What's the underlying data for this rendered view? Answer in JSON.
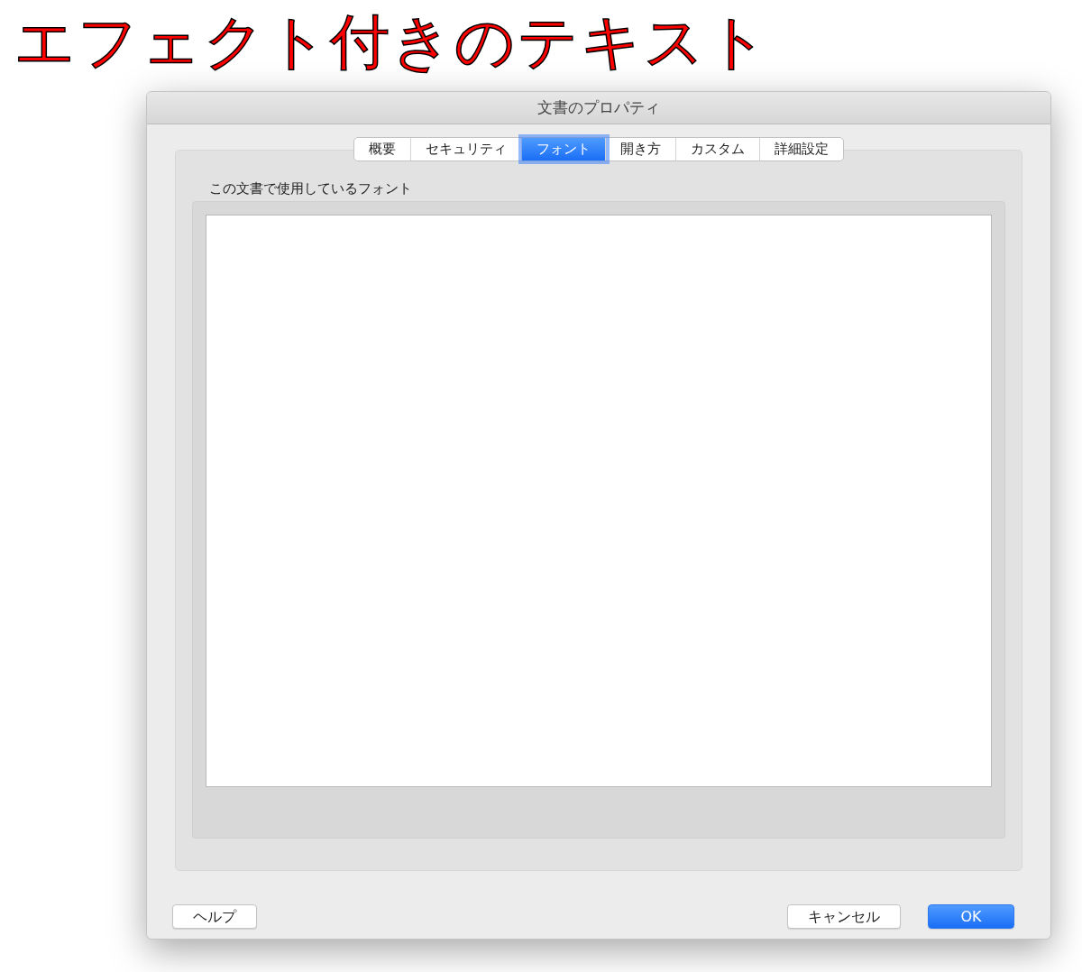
{
  "heading": "エフェクト付きのテキスト",
  "window": {
    "title": "文書のプロパティ"
  },
  "tabs": [
    {
      "label": "概要",
      "selected": false
    },
    {
      "label": "セキュリティ",
      "selected": false
    },
    {
      "label": "フォント",
      "selected": true
    },
    {
      "label": "開き方",
      "selected": false
    },
    {
      "label": "カスタム",
      "selected": false
    },
    {
      "label": "詳細設定",
      "selected": false
    }
  ],
  "fonts_panel": {
    "label": "この文書で使用しているフォント"
  },
  "buttons": [
    {
      "label": "ヘルプ",
      "default": false
    },
    {
      "label": "キャンセル",
      "default": false
    },
    {
      "label": "OK",
      "default": true
    }
  ]
}
